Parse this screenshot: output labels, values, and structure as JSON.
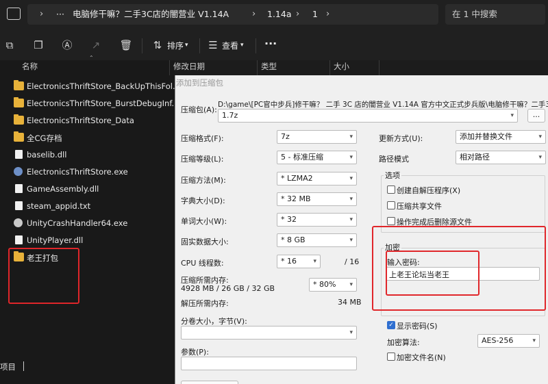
{
  "addressbar": {
    "more": "···",
    "crumbs": [
      "电脑修干嘛？二手3C店的闇营业 V1.14A",
      "1.14a",
      "1"
    ],
    "search_placeholder": "在 1 中搜索"
  },
  "toolbar": {
    "sort_label": "排序",
    "view_label": "查看",
    "more_label": "···"
  },
  "columns": {
    "name": "名称",
    "modified": "修改日期",
    "type": "类型",
    "size": "大小"
  },
  "files": [
    {
      "icon": "folder",
      "name": "ElectronicsThriftStore_BackUpThisFol..."
    },
    {
      "icon": "folder",
      "name": "ElectronicsThriftStore_BurstDebugInf..."
    },
    {
      "icon": "folder",
      "name": "ElectronicsThriftStore_Data"
    },
    {
      "icon": "folder",
      "name": "全CG存档"
    },
    {
      "icon": "doc",
      "name": "baselib.dll"
    },
    {
      "icon": "exe",
      "name": "ElectronicsThriftStore.exe"
    },
    {
      "icon": "doc",
      "name": "GameAssembly.dll"
    },
    {
      "icon": "doc",
      "name": "steam_appid.txt"
    },
    {
      "icon": "gear",
      "name": "UnityCrashHandler64.exe"
    },
    {
      "icon": "doc",
      "name": "UnityPlayer.dll"
    },
    {
      "icon": "folder",
      "name": "老王打包"
    }
  ],
  "status": {
    "items_label": "项目"
  },
  "dialog": {
    "title": "添加到压缩包",
    "archive_label": "压缩包(A):",
    "archive_path": "D:\\game\\[PC官中步兵]修干嘛？ 二手 3C 店的闇营业 V1.14A 官方中文正式步兵版\\电脑修干嘛？二手3C",
    "archive_ext": "1.7z",
    "browse_label": "...",
    "format_label": "压缩格式(F):",
    "format_value": "7z",
    "level_label": "压缩等级(L):",
    "level_value": "5 - 标准压缩",
    "method_label": "压缩方法(M):",
    "method_value": "* LZMA2",
    "dict_label": "字典大小(D):",
    "dict_value": "* 32 MB",
    "word_label": "单词大小(W):",
    "word_value": "* 32",
    "solid_label": "固实数据大小:",
    "solid_value": "* 8 GB",
    "cpu_label": "CPU 线程数:",
    "cpu_value": "* 16",
    "cpu_total": "/ 16",
    "mem_label": "压缩所需内存:",
    "mem_detail": "4928 MB / 26 GB / 32 GB",
    "mem_percent": "* 80%",
    "decomp_label": "解压所需内存:",
    "decomp_value": "34 MB",
    "split_label": "分卷大小，字节(V):",
    "params_label": "参数(P):",
    "update_label": "更新方式(U):",
    "update_value": "添加并替换文件",
    "path_label": "路径模式",
    "path_value": "相对路径",
    "options_title": "选项",
    "opt_sfx": "创建自解压程序(X)",
    "opt_shared": "压缩共享文件",
    "opt_delete": "操作完成后删除源文件",
    "enc_title": "加密",
    "pwd_label": "输入密码:",
    "pwd_value": "上老王论坛当老王",
    "show_pwd": "显示密码(S)",
    "algo_label": "加密算法:",
    "algo_value": "AES-256",
    "enc_names": "加密文件名(N)"
  }
}
